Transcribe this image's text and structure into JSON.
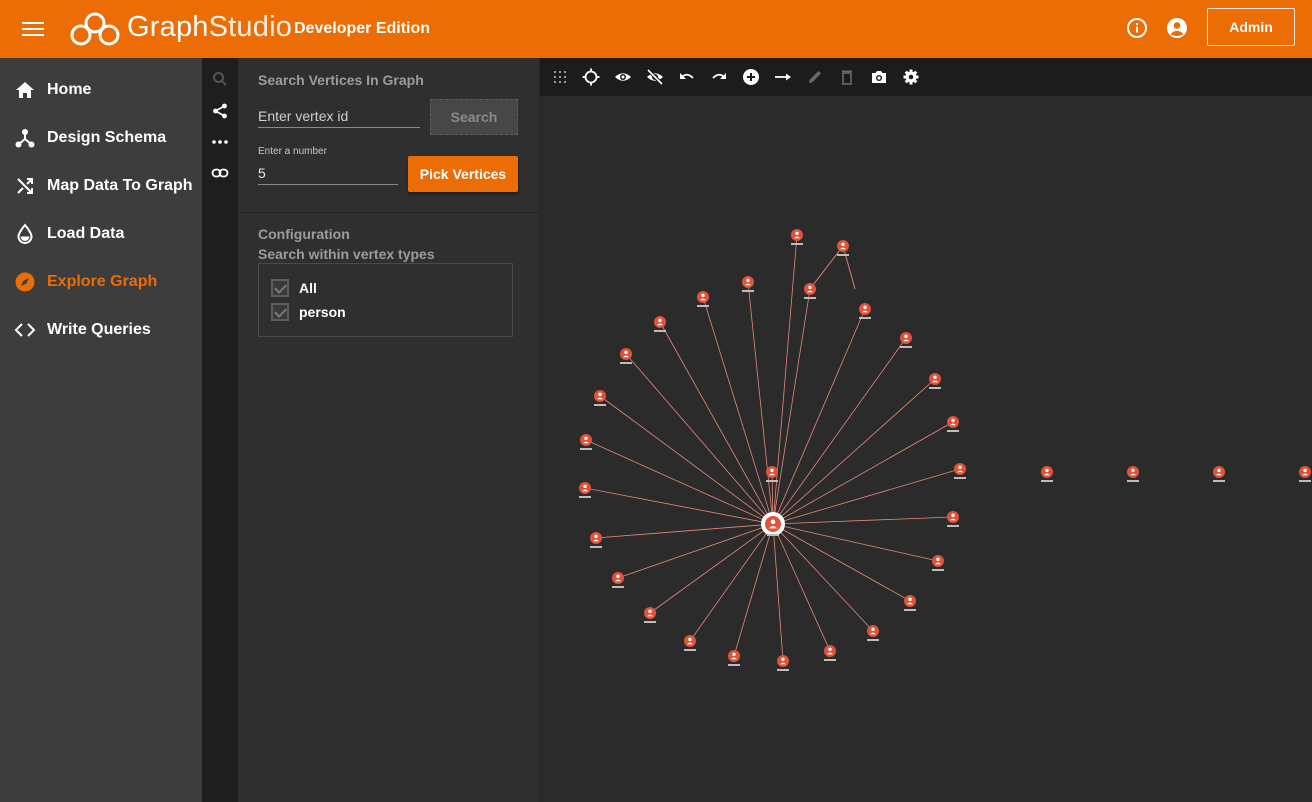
{
  "header": {
    "brand_main": "Graph",
    "brand_thin": "Studio",
    "edition": "Developer Edition",
    "admin_label": "Admin",
    "accent_color": "#ec6c05"
  },
  "sidebar": {
    "items": [
      {
        "label": "Home",
        "icon": "home-icon"
      },
      {
        "label": "Design Schema",
        "icon": "schema-icon"
      },
      {
        "label": "Map Data To Graph",
        "icon": "shuffle-icon"
      },
      {
        "label": "Load Data",
        "icon": "drop-icon"
      },
      {
        "label": "Explore Graph",
        "icon": "compass-icon",
        "active": true
      },
      {
        "label": "Write Queries",
        "icon": "code-icon"
      }
    ]
  },
  "icon_strip": [
    "search-icon",
    "share-icon",
    "more-horiz-icon",
    "link-icon"
  ],
  "search_panel": {
    "title": "Search Vertices In Graph",
    "vertex_placeholder": "Enter vertex id",
    "search_label": "Search",
    "number_label": "Enter a number",
    "number_value": "5",
    "pick_label": "Pick Vertices"
  },
  "configuration": {
    "title": "Configuration",
    "subtitle": "Search within vertex types",
    "types": [
      {
        "label": "All",
        "checked": true
      },
      {
        "label": "person",
        "checked": true
      }
    ]
  },
  "toolbar": [
    "grid-icon",
    "locate-icon",
    "eye-icon",
    "eye-off-icon",
    "undo-icon",
    "redo-icon",
    "add-vertex-icon",
    "add-edge-icon",
    "edit-icon",
    "delete-icon",
    "camera-icon",
    "settings-icon"
  ]
}
